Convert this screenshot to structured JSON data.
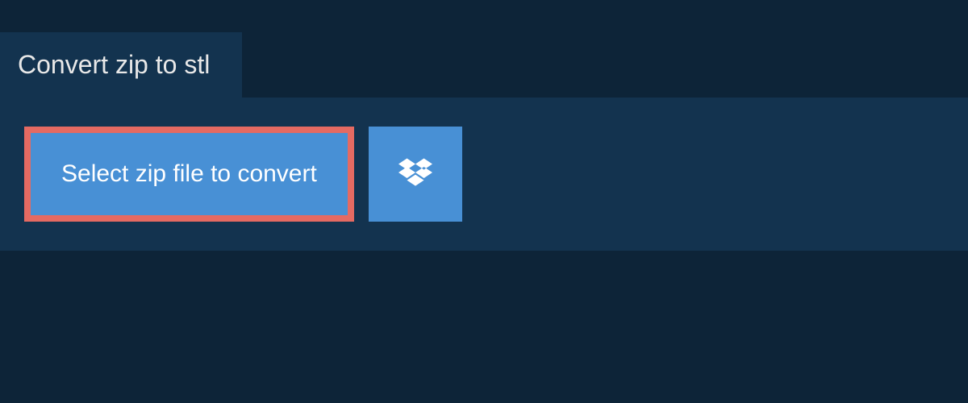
{
  "tab": {
    "title": "Convert zip to stl"
  },
  "actions": {
    "select_file_label": "Select zip file to convert"
  },
  "colors": {
    "page_bg": "#0d2438",
    "panel_bg": "#13334f",
    "button_bg": "#4890d5",
    "highlight_border": "#e56a62"
  }
}
